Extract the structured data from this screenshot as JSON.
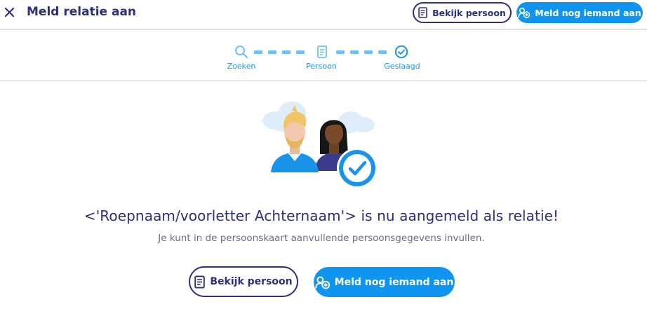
{
  "header": {
    "title": "Meld relatie aan",
    "view_person_label": "Bekijk persoon",
    "add_another_label": "Meld nog iemand aan"
  },
  "stepper": {
    "steps": [
      {
        "label": "Zoeken",
        "icon": "search-icon",
        "status": "done"
      },
      {
        "label": "Persoon",
        "icon": "person-card-icon",
        "status": "done"
      },
      {
        "label": "Geslaagd",
        "icon": "check-circle-icon",
        "status": "current"
      }
    ]
  },
  "main": {
    "headline": "<'Roepnaam/voorletter Achternaam'> is nu aangemeld als relatie!",
    "subline": "Je kunt in de persoonskaart aanvullende persoonsgegevens invullen.",
    "view_person_label": "Bekijk persoon",
    "add_another_label": "Meld nog iemand aan"
  },
  "colors": {
    "primary_dark": "#2e2f7a",
    "accent_blue": "#0f95ef",
    "step_blue": "#1f94e6"
  }
}
